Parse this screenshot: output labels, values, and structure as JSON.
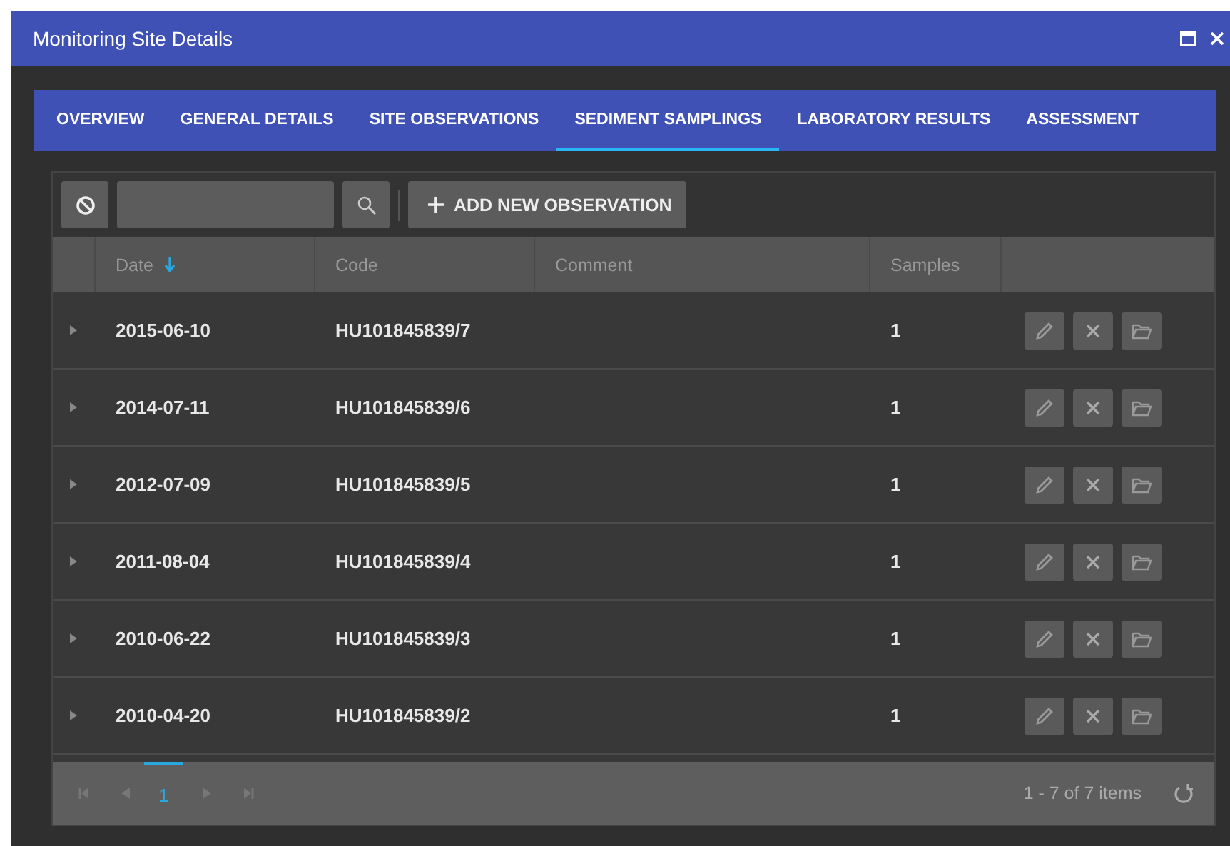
{
  "window": {
    "title": "Monitoring Site Details"
  },
  "tabs": [
    {
      "label": "OVERVIEW",
      "selected": false
    },
    {
      "label": "GENERAL DETAILS",
      "selected": false
    },
    {
      "label": "SITE OBSERVATIONS",
      "selected": false
    },
    {
      "label": "SEDIMENT SAMPLINGS",
      "selected": true
    },
    {
      "label": "LABORATORY RESULTS",
      "selected": false
    },
    {
      "label": "ASSESSMENT",
      "selected": false
    }
  ],
  "toolbar": {
    "add_button": "ADD NEW OBSERVATION"
  },
  "table": {
    "columns": [
      {
        "label": "Date",
        "sorted": true
      },
      {
        "label": "Code",
        "sorted": false
      },
      {
        "label": "Comment",
        "sorted": false
      },
      {
        "label": "Samples",
        "sorted": false
      }
    ],
    "rows": [
      {
        "date": "2015-06-10",
        "code": "HU101845839/7",
        "samples": "1"
      },
      {
        "date": "2014-07-11",
        "code": "HU101845839/6",
        "samples": "1"
      },
      {
        "date": "2012-07-09",
        "code": "HU101845839/5",
        "samples": "1"
      },
      {
        "date": "2011-08-04",
        "code": "HU101845839/4",
        "samples": "1"
      },
      {
        "date": "2010-06-22",
        "code": "HU101845839/3",
        "samples": "1"
      },
      {
        "date": "2010-04-20",
        "code": "HU101845839/2",
        "samples": "1"
      }
    ]
  },
  "pager": {
    "pages": [
      {
        "label": "1",
        "selected": true
      }
    ],
    "summary": "1 - 7 of 7 items"
  }
}
